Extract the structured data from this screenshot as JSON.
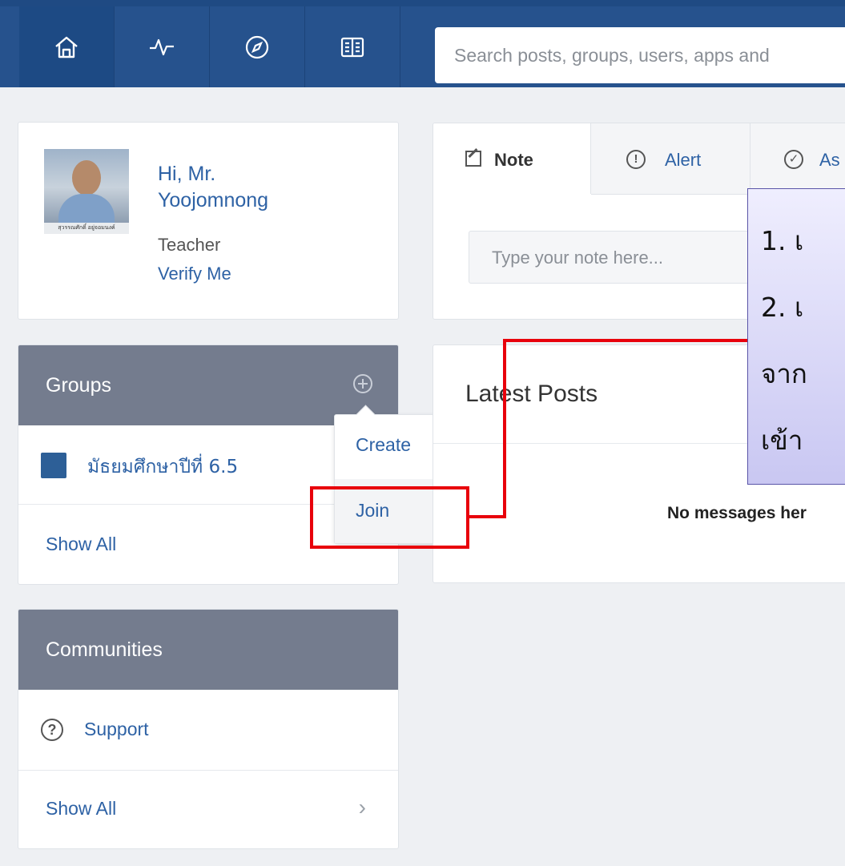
{
  "nav": {
    "items": [
      {
        "icon": "home-icon"
      },
      {
        "icon": "activity-icon"
      },
      {
        "icon": "compass-icon"
      },
      {
        "icon": "book-icon"
      }
    ],
    "search_placeholder": "Search posts, groups, users, apps and"
  },
  "profile": {
    "greeting_line1": "Hi, Mr.",
    "greeting_line2": "Yoojomnong",
    "role": "Teacher",
    "verify_link": "Verify Me",
    "avatar_caption": "สุวรรณศักดิ์ อยู่จอมนงค์"
  },
  "groups": {
    "title": "Groups",
    "item_label": "มัธยมศึกษาปีที่ 6.5",
    "item_color": "#2d5f97",
    "show_all": "Show All",
    "menu": {
      "create": "Create",
      "join": "Join"
    }
  },
  "communities": {
    "title": "Communities",
    "item_label": "Support",
    "show_all": "Show All"
  },
  "composer": {
    "tabs": [
      {
        "label": "Note",
        "icon": "note-icon"
      },
      {
        "label": "Alert",
        "icon": "alert-icon"
      },
      {
        "label": "As",
        "icon": "check-circle-icon"
      }
    ],
    "note_placeholder": "Type your note here..."
  },
  "latest_posts": {
    "title": "Latest Posts",
    "empty_message": "No messages her"
  },
  "callout": {
    "line1": "1. เ",
    "line2": "2. เ",
    "line3": "จาก",
    "line4": "เข้า"
  },
  "colors": {
    "topbar": "#26528d",
    "accent_blue": "#2e62a5",
    "panel_header": "#747c8e",
    "highlight_red": "#e8000b"
  }
}
